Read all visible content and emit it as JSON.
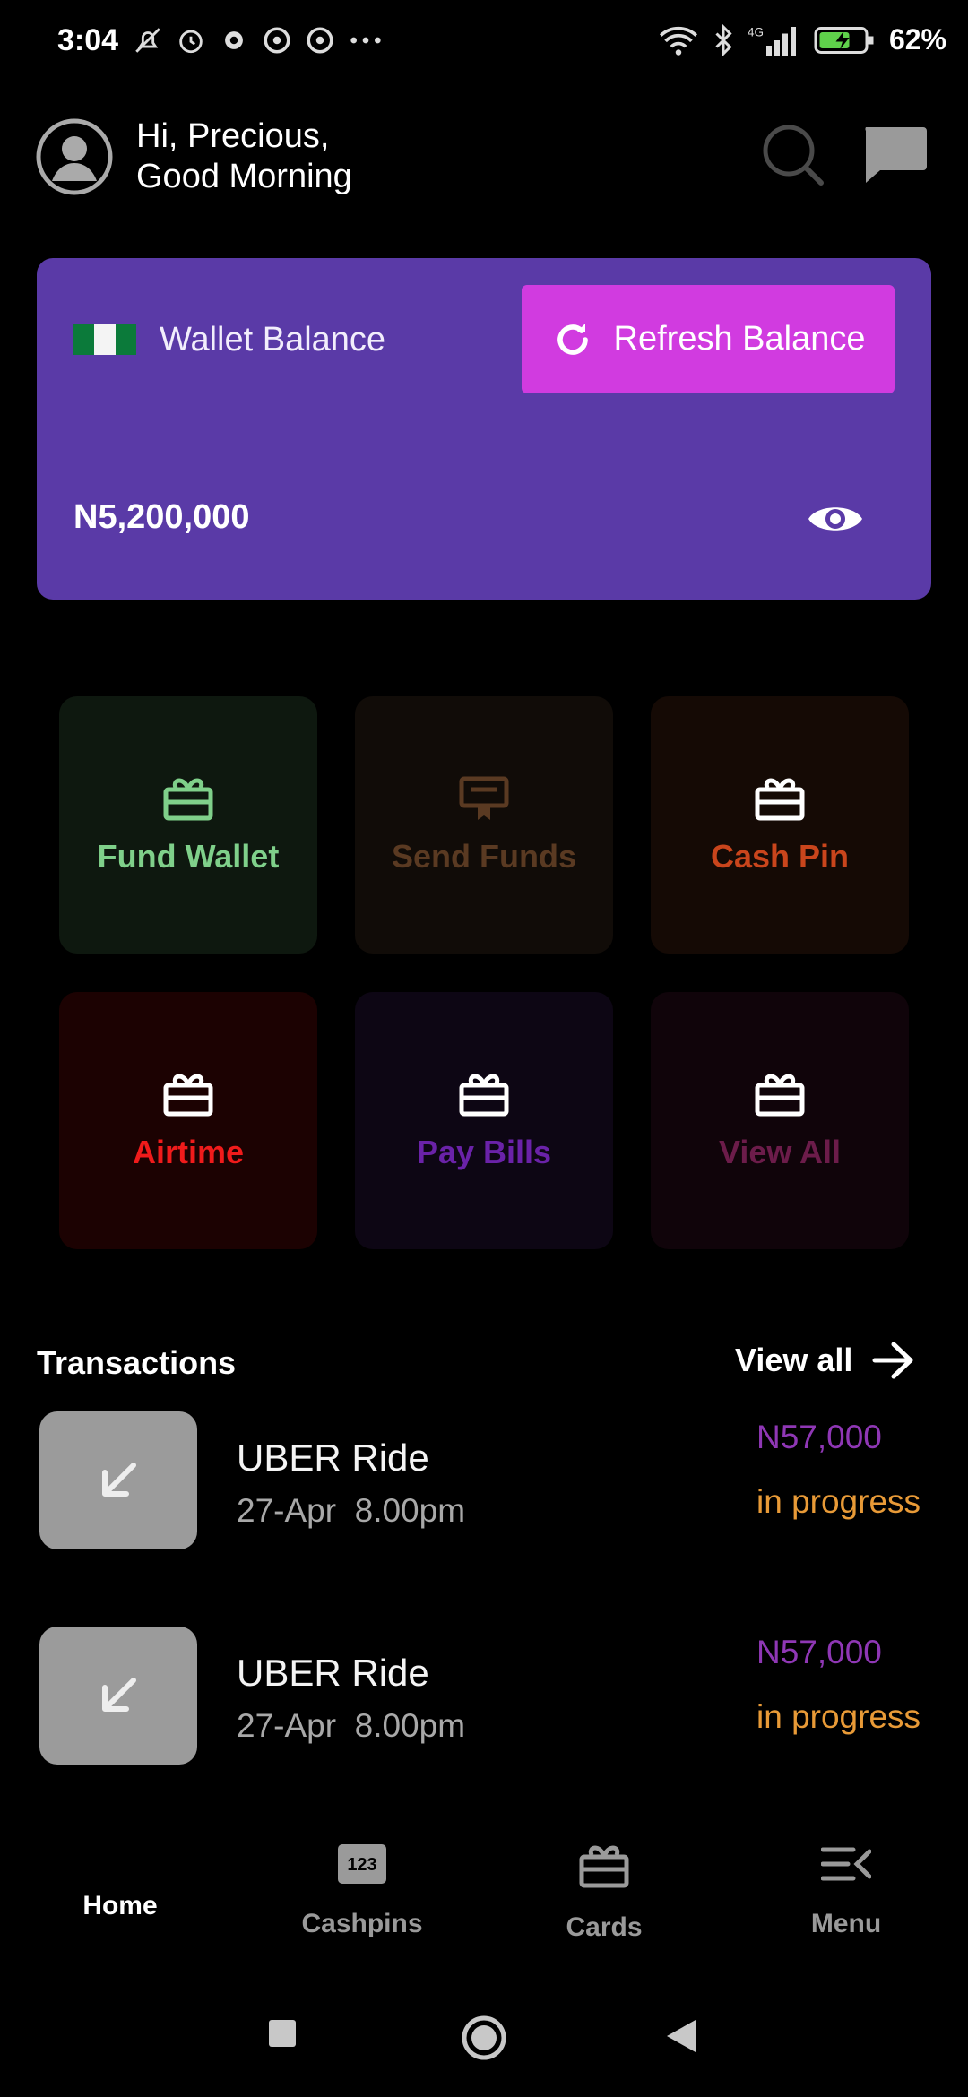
{
  "status_bar": {
    "time": "3:04",
    "battery_percent": "62%",
    "network_label": "4G"
  },
  "header": {
    "greeting_line1": "Hi, Precious,",
    "greeting_line2": "Good Morning",
    "icons": [
      "avatar-icon",
      "search-icon",
      "chat-icon"
    ]
  },
  "wallet": {
    "label": "Wallet Balance",
    "refresh_label": "Refresh Balance",
    "balance": "N5,200,000",
    "card_color": "#5a3aa7",
    "button_color": "#d13be0"
  },
  "quick_actions": [
    {
      "label": "Fund Wallet",
      "icon": "gift-icon",
      "color": "#7fd08a",
      "bg": "#0e180f"
    },
    {
      "label": "Send Funds",
      "icon": "certificate-icon",
      "color": "#5a3a22",
      "bg": "#110c08"
    },
    {
      "label": "Cash Pin",
      "icon": "gift-icon",
      "color": "#c9451c",
      "bg": "#150a05"
    },
    {
      "label": "Airtime",
      "icon": "gift-icon",
      "color": "#f01b1b",
      "bg": "#1c0202"
    },
    {
      "label": "Pay Bills",
      "icon": "gift-icon",
      "color": "#6a22a8",
      "bg": "#0d0614"
    },
    {
      "label": "View All",
      "icon": "gift-icon",
      "color": "#6c1c4a",
      "bg": "#10040a"
    }
  ],
  "transactions": {
    "title": "Transactions",
    "view_all": "View all",
    "items": [
      {
        "name": "UBER Ride",
        "date": "27-Apr",
        "time": "8.00pm",
        "amount": "N57,000",
        "status": "in progress"
      },
      {
        "name": "UBER Ride",
        "date": "27-Apr",
        "time": "8.00pm",
        "amount": "N57,000",
        "status": "in progress"
      }
    ]
  },
  "bottom_nav": {
    "items": [
      {
        "label": "Home",
        "active": true
      },
      {
        "label": "Cashpins",
        "icon_text": "123"
      },
      {
        "label": "Cards"
      },
      {
        "label": "Menu"
      }
    ]
  }
}
